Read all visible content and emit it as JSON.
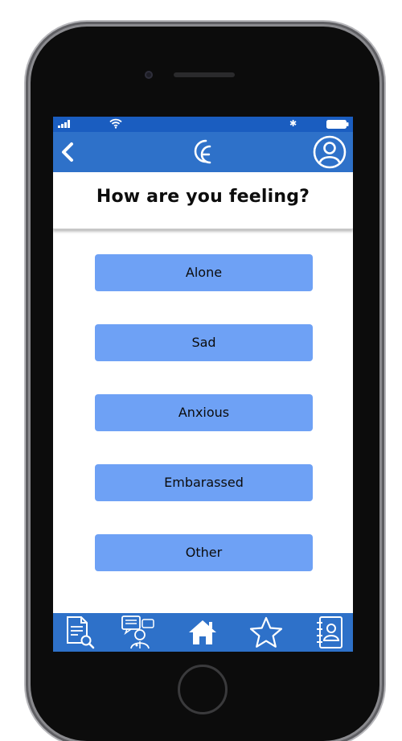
{
  "app": {
    "logo_label": "CE",
    "colors": {
      "status_bar": "#1a5dc0",
      "nav_bar": "#2e71c9",
      "option_button": "#6ea1f5",
      "title_text": "#0d0d0d"
    }
  },
  "status_bar": {
    "icons": [
      "signal-icon",
      "wifi-icon",
      "bluetooth-icon",
      "battery-icon"
    ]
  },
  "nav": {
    "back_icon": "chevron-left-icon",
    "profile_icon": "user-circle-icon"
  },
  "header": {
    "title": "How are you feeling?"
  },
  "options": [
    {
      "label": "Alone"
    },
    {
      "label": "Sad"
    },
    {
      "label": "Anxious"
    },
    {
      "label": "Embarassed"
    },
    {
      "label": "Other"
    }
  ],
  "tab_bar": {
    "tabs": [
      {
        "icon": "document-search-icon"
      },
      {
        "icon": "chat-doctor-icon"
      },
      {
        "icon": "home-icon"
      },
      {
        "icon": "star-icon"
      },
      {
        "icon": "contacts-book-icon"
      }
    ]
  }
}
